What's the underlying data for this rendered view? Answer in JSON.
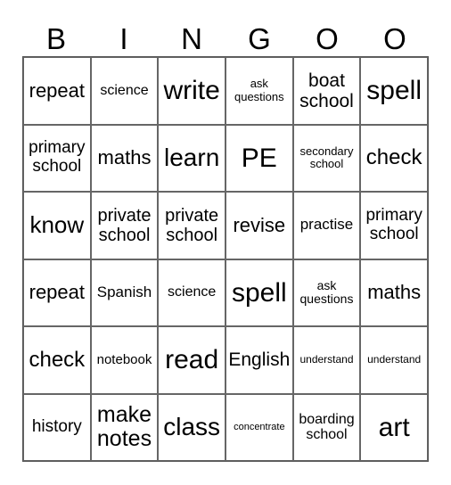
{
  "header": [
    "B",
    "I",
    "N",
    "G",
    "O",
    "O"
  ],
  "cells": [
    [
      "repeat",
      "science",
      "write",
      "ask questions",
      "boat school",
      "spell"
    ],
    [
      "primary school",
      "maths",
      "learn",
      "PE",
      "secondary school",
      "check"
    ],
    [
      "know",
      "private school",
      "private school",
      "revise",
      "practise",
      "primary school"
    ],
    [
      "repeat",
      "Spanish",
      "science",
      "spell",
      "ask questions",
      "maths"
    ],
    [
      "check",
      "notebook",
      "read",
      "English",
      "understand",
      "understand"
    ],
    [
      "history",
      "make notes",
      "class",
      "concentrate",
      "boarding school",
      "art"
    ]
  ]
}
